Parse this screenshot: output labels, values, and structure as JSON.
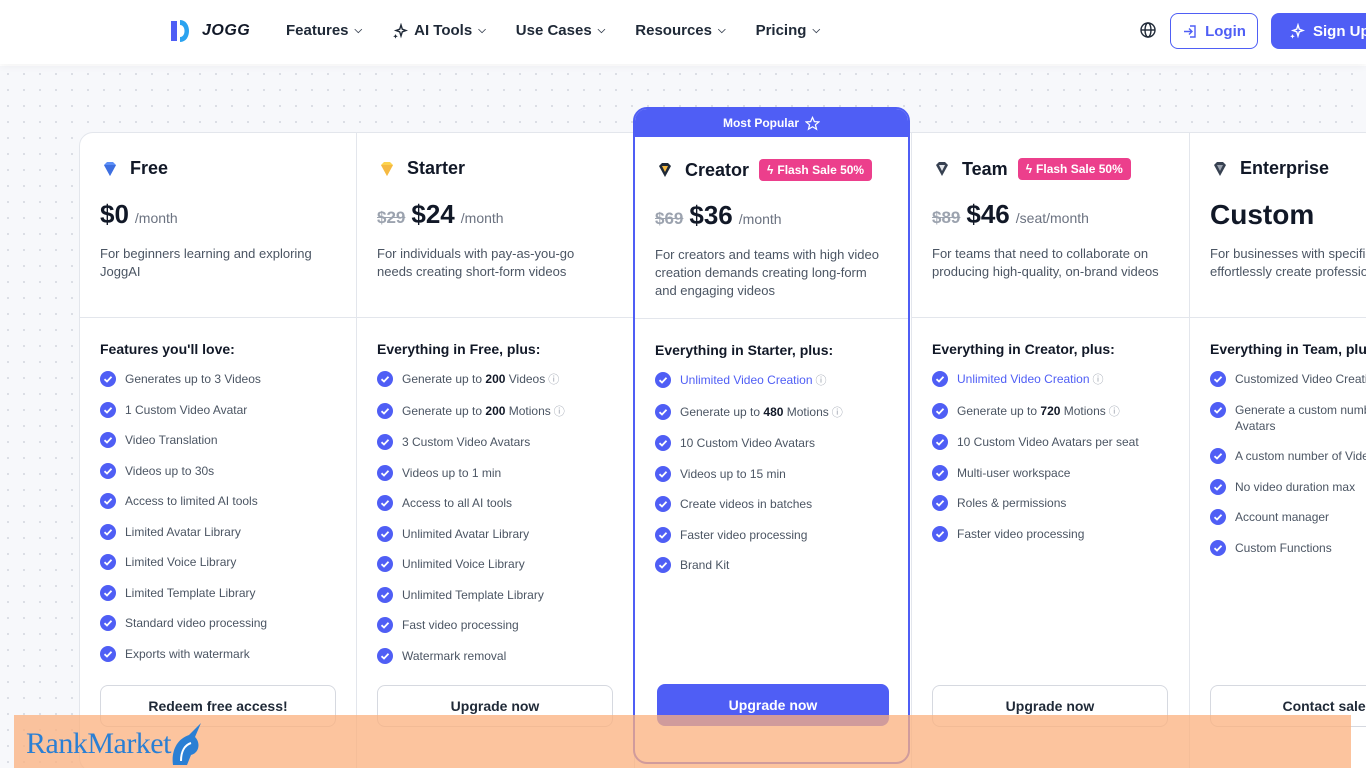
{
  "nav": {
    "logo": "JOGG",
    "menu": [
      {
        "label": "Features",
        "icon": ""
      },
      {
        "label": "AI Tools",
        "icon": "sparkle-icon"
      },
      {
        "label": "Use Cases",
        "icon": ""
      },
      {
        "label": "Resources",
        "icon": ""
      },
      {
        "label": "Pricing",
        "icon": ""
      }
    ],
    "login": "Login",
    "signup": "Sign Up"
  },
  "colors": {
    "accent": "#4f5ef5",
    "flash": "#ec3f8c",
    "watermark_bg": "#fbb07e"
  },
  "plans": [
    {
      "name": "Free",
      "old_price": "",
      "price": "$0",
      "per": "/month",
      "flash": "",
      "desc": "For beginners learning and exploring JoggAI",
      "features_title": "Features you'll love:",
      "features": [
        "Generates up to 3 Videos",
        "1 Custom Video Avatar",
        "Video Translation",
        "Videos up to 30s",
        "Access to limited AI tools",
        "Limited Avatar Library",
        "Limited Voice Library",
        "Limited Template Library",
        "Standard video processing",
        "Exports with watermark"
      ],
      "button": "Redeem free access!"
    },
    {
      "name": "Starter",
      "old_price": "$29",
      "price": "$24",
      "per": "/month",
      "flash": "",
      "desc": "For individuals with pay-as-you-go needs creating short-form videos",
      "features_title": "Everything in Free, plus:",
      "features_rich": [
        {
          "pre": "Generate up to ",
          "bold": "200",
          "post": " Videos",
          "info": true
        },
        {
          "pre": "Generate up to ",
          "bold": "200",
          "post": " Motions",
          "info": true
        }
      ],
      "features": [
        "3 Custom Video Avatars",
        "Videos up to 1 min",
        "Access to all AI tools",
        "Unlimited Avatar Library",
        "Unlimited Voice Library",
        "Unlimited Template Library",
        "Fast video processing",
        "Watermark removal"
      ],
      "button": "Upgrade now"
    },
    {
      "name": "Creator",
      "old_price": "$69",
      "price": "$36",
      "per": "/month",
      "flash": "Flash Sale 50%",
      "badge": "Most Popular",
      "desc": "For creators and teams with high video creation demands creating long-form and engaging videos",
      "features_title": "Everything in Starter, plus:",
      "highlight": "Unlimited Video Creation",
      "features_rich": [
        {
          "pre": "Generate up to ",
          "bold": "480",
          "post": " Motions",
          "info": true
        }
      ],
      "features": [
        "10 Custom Video Avatars",
        "Videos up to 15 min",
        "Create videos in batches",
        "Faster video processing",
        "Brand Kit"
      ],
      "button": "Upgrade now"
    },
    {
      "name": "Team",
      "old_price": "$89",
      "price": "$46",
      "per": "/seat/month",
      "flash": "Flash Sale 50%",
      "desc": "For teams that need to collaborate on producing high-quality, on-brand videos",
      "features_title": "Everything in Creator, plus:",
      "highlight": "Unlimited Video Creation",
      "features_rich": [
        {
          "pre": "Generate up to ",
          "bold": "720",
          "post": " Motions",
          "info": true
        }
      ],
      "features": [
        "10 Custom Video Avatars per seat",
        "Multi-user workspace",
        "Roles & permissions",
        "Faster video processing"
      ],
      "button": "Upgrade now"
    },
    {
      "name": "Enterprise",
      "old_price": "",
      "price": "Custom",
      "per": "",
      "flash": "",
      "desc": "For businesses with specific needs to effortlessly create professional videos",
      "features_title": "Everything in Team, plus:",
      "features": [
        "Customized Video Creation",
        "Generate a custom number of Video Avatars",
        "A custom number of Videos",
        "No video duration max",
        "Account manager",
        "Custom Functions"
      ],
      "button": "Contact sales"
    }
  ],
  "watermark": {
    "text": "RankMarket"
  }
}
